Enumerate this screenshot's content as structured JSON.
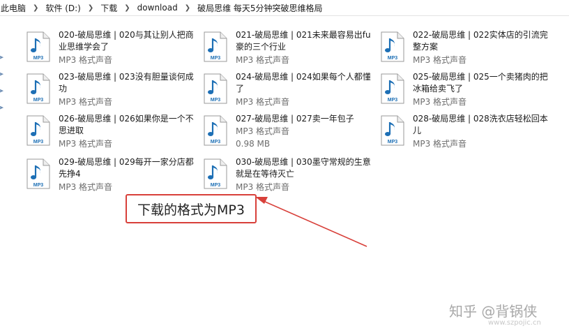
{
  "breadcrumb": [
    "此电脑",
    "软件 (D:)",
    "下载",
    "download",
    "破局思维 每天5分钟突破思维格局"
  ],
  "files": [
    {
      "name": "020-破局思维 | 020与其让别人把商业思维学会了",
      "meta": "MP3 格式声音"
    },
    {
      "name": "021-破局思维 | 021未来最容易出fu豪的三个行业",
      "meta": "MP3 格式声音"
    },
    {
      "name": "022-破局思维 | 022实体店的引流完整方案",
      "meta": "MP3 格式声音"
    },
    {
      "name": "023-破局思维 | 023没有胆量谈何成功",
      "meta": "MP3 格式声音"
    },
    {
      "name": "024-破局思维 | 024如果每个人都懂了",
      "meta": "MP3 格式声音"
    },
    {
      "name": "025-破局思维 | 025一个卖猪肉的把冰箱给卖飞了",
      "meta": "MP3 格式声音"
    },
    {
      "name": "026-破局思维 | 026如果你是一个不思进取",
      "meta": "MP3 格式声音"
    },
    {
      "name": "027-破局思维 | 027卖一年包子",
      "meta": "MP3 格式声音",
      "size": "0.98 MB"
    },
    {
      "name": "028-破局思维 | 028洗衣店轻松回本儿",
      "meta": "MP3 格式声音"
    },
    {
      "name": "029-破局思维 | 029每开一家分店都先挣4",
      "meta": "MP3 格式声音"
    },
    {
      "name": "030-破局思维 | 030墨守常规的生意就是在等待灭亡",
      "meta": "MP3 格式声音"
    }
  ],
  "icon_label": "MP3",
  "callout_text": "下载的格式为MP3",
  "watermark": "知乎 @背锅侠",
  "watermark_small": "www.szpojic.cn",
  "colors": {
    "accent": "#d8403a",
    "icon_blue": "#1d6fb5",
    "meta_gray": "#6d6d6d"
  }
}
